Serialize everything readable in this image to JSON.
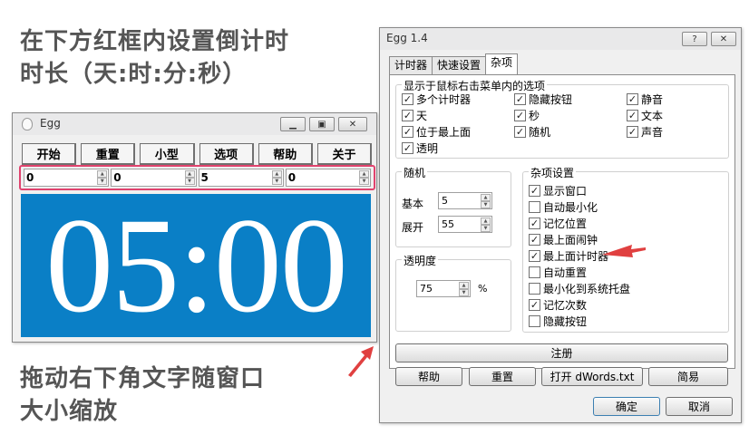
{
  "captions": {
    "top_line1": "在下方红框内设置倒计时",
    "top_line2": "时长（天:时:分:秒）",
    "bottom_line1": "拖动右下角文字随窗口",
    "bottom_line2": "大小缩放"
  },
  "egg_window": {
    "title": "Egg",
    "toolbar": [
      "开始",
      "重置",
      "小型",
      "选项",
      "帮助",
      "关于"
    ],
    "fields": [
      "0",
      "0",
      "5",
      "0"
    ],
    "display": "05:00",
    "display_color": "#0a7fc6"
  },
  "dialog": {
    "title": "Egg 1.4",
    "help_btn": "?",
    "close_btn": "✕",
    "tabs": [
      "计时器",
      "快速设置",
      "杂项"
    ],
    "context_menu": {
      "label": "显示于鼠标右击菜单内的选项",
      "items": [
        {
          "label": "多个计时器",
          "checked": true
        },
        {
          "label": "隐藏按钮",
          "checked": true
        },
        {
          "label": "静音",
          "checked": true
        },
        {
          "label": "天",
          "checked": true
        },
        {
          "label": "秒",
          "checked": true
        },
        {
          "label": "文本",
          "checked": true
        },
        {
          "label": "位于最上面",
          "checked": true
        },
        {
          "label": "随机",
          "checked": true
        },
        {
          "label": "声音",
          "checked": true
        },
        {
          "label": "透明",
          "checked": true
        }
      ]
    },
    "random": {
      "label": "随机",
      "base_label": "基本",
      "base_value": "5",
      "expand_label": "展开",
      "expand_value": "55"
    },
    "opacity": {
      "label": "透明度",
      "value": "75",
      "unit": "%"
    },
    "misc": {
      "label": "杂项设置",
      "items": [
        {
          "label": "显示窗口",
          "checked": true
        },
        {
          "label": "自动最小化",
          "checked": false
        },
        {
          "label": "记忆位置",
          "checked": true
        },
        {
          "label": "最上面闹钟",
          "checked": true
        },
        {
          "label": "最上面计时器",
          "checked": true
        },
        {
          "label": "自动重置",
          "checked": false
        },
        {
          "label": "最小化到系统托盘",
          "checked": false
        },
        {
          "label": "记忆次数",
          "checked": true
        },
        {
          "label": "隐藏按钮",
          "checked": false
        }
      ]
    },
    "register_btn": "注册",
    "bottom_buttons": [
      "帮助",
      "重置",
      "打开 dWords.txt",
      "简易"
    ],
    "ok_btn": "确定",
    "cancel_btn": "取消"
  },
  "colors": {
    "highlight_frame": "#e0436e",
    "arrow": "#e04040"
  }
}
